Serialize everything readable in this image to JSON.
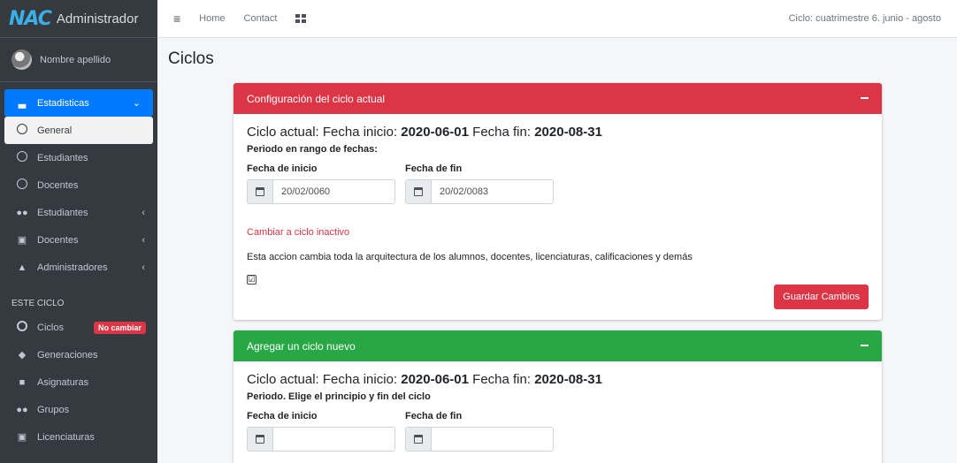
{
  "brand": {
    "logo": "NAC",
    "title": "Administrador"
  },
  "user": {
    "name": "Nombre apellido"
  },
  "sidebar": {
    "items": [
      {
        "label": "Estadisticas",
        "icon": "chart-bar-icon"
      },
      {
        "label": "General",
        "icon": "circle-icon"
      },
      {
        "label": "Estudiantes",
        "icon": "circle-icon"
      },
      {
        "label": "Docentes",
        "icon": "circle-icon"
      },
      {
        "label": "Estudiantes",
        "icon": "users-icon"
      },
      {
        "label": "Docentes",
        "icon": "chalkboard-icon"
      },
      {
        "label": "Administradores",
        "icon": "user-tie-icon"
      }
    ],
    "section_header": "ESTE CICLO",
    "section_items": [
      {
        "label": "Ciclos",
        "badge": "No cambiar",
        "icon": "circle-icon"
      },
      {
        "label": "Generaciones",
        "icon": "graduation-cap-icon"
      },
      {
        "label": "Asignaturas",
        "icon": "book-icon"
      },
      {
        "label": "Grupos",
        "icon": "users-icon"
      },
      {
        "label": "Licenciaturas",
        "icon": "chalkboard-teacher-icon"
      }
    ]
  },
  "topbar": {
    "home": "Home",
    "contact": "Contact",
    "cycle_info": "Ciclo: cuatrimestre 6. junio - agosto"
  },
  "page": {
    "title": "Ciclos"
  },
  "card_current": {
    "header": "Configuración del ciclo actual",
    "cur_prefix": "Ciclo actual: Fecha inicio:",
    "start": "2020-06-01",
    "mid": "Fecha fin:",
    "end": "2020-08-31",
    "periodo": "Periodo en rango de fechas:",
    "start_label": "Fecha de inicio",
    "end_label": "Fecha de fin",
    "start_value": "20/02/0060",
    "end_value": "20/02/0083",
    "warn_link": "Cambiar a ciclo inactivo",
    "warn_text": "Esta accion cambia toda la arquitectura de los alumnos, docentes, licenciaturas, calificaciones y demás",
    "checkbox_mark": "☑",
    "save_label": "Guardar Cambios"
  },
  "card_new": {
    "header": "Agregar un ciclo nuevo",
    "cur_prefix": "Ciclo actual: Fecha inicio:",
    "start": "2020-06-01",
    "mid": "Fecha fin:",
    "end": "2020-08-31",
    "periodo": "Periodo. Elige el principio y fin del ciclo",
    "start_label": "Fecha de inicio",
    "end_label": "Fecha de fin",
    "start_value": "",
    "end_value": ""
  },
  "colors": {
    "primary": "#007bff",
    "danger": "#dc3545",
    "success": "#28a745",
    "sidebar": "#343a40"
  }
}
